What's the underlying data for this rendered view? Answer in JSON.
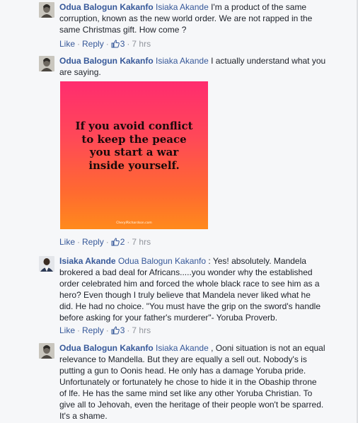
{
  "comments": [
    {
      "author": "Odua Balogun Kakanfo",
      "mention": "Isiaka Akande",
      "text_first": " I'm a product of the same",
      "text_lines": [
        "corruption, known as the new world order. We are not rapped in the",
        "same Christmas gift. How come ?"
      ],
      "actions": {
        "like": "Like",
        "reply": "Reply",
        "likes": "3",
        "time": "7 hrs"
      }
    },
    {
      "author": "Odua Balogun Kakanfo",
      "mention": "Isiaka Akande",
      "text_first": " I actually understand what you",
      "text_lines": [
        "are saying."
      ],
      "image": {
        "quote_lines": [
          "If you avoid conflict",
          "to keep the peace",
          "you start a war",
          "inside yourself."
        ],
        "credit": "CherylRichardson.com"
      },
      "actions": {
        "like": "Like",
        "reply": "Reply",
        "likes": "2",
        "time": "7 hrs"
      }
    },
    {
      "author": "Isiaka Akande",
      "mention": "Odua Balogun Kakanfo",
      "text_first": " : Yes! absolutely. Mandela",
      "text_lines": [
        "brokered a bad deal for Africans.....you wonder why the established",
        "order celebrated him and forced the whole black race to see him as a",
        "hero? Even though I truly believe that Mandela never liked what he",
        "did. He had no choice. \"You must have the grip on the sword's handle",
        "before asking for your father's murderer\"- Yoruba Proverb."
      ],
      "actions": {
        "like": "Like",
        "reply": "Reply",
        "likes": "3",
        "time": "7 hrs"
      }
    },
    {
      "author": "Odua Balogun Kakanfo",
      "mention": "Isiaka Akande",
      "text_first": " , Ooni situation is not an equal",
      "text_lines": [
        "relevance to Mandella. But they are equally a sell out. Nobody's is",
        "putting a gun to Oonis head. He only has a damage Yoruba pride.",
        "Unfortunately or fortunately he chose to hide it in the Obaship throne",
        "of lfe. He has the same mind set like any other Yoruba Christian. To",
        "give all to Jehovah, even the heritage of their people won't be sparred.",
        "It's a shame."
      ]
    }
  ]
}
